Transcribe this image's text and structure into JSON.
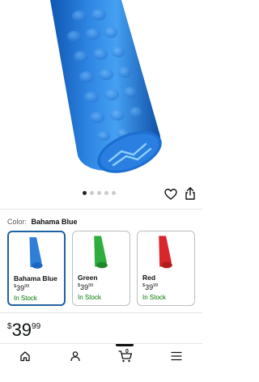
{
  "product": {
    "image_alt": "Blue textured grip",
    "carousel": {
      "total": 5,
      "active_index": 0
    },
    "selected_color_key": "Color:",
    "selected_color_value": "Bahama Blue"
  },
  "swatches": [
    {
      "name": "Bahama Blue",
      "price_symbol": "$",
      "price_whole": "39",
      "price_fraction": "99",
      "stock": "In Stock",
      "color": "#2f7fd8",
      "selected": true
    },
    {
      "name": "Green",
      "price_symbol": "$",
      "price_whole": "39",
      "price_fraction": "99",
      "stock": "In Stock",
      "color": "#2fae3e",
      "selected": false
    },
    {
      "name": "Red",
      "price_symbol": "$",
      "price_whole": "39",
      "price_fraction": "99",
      "stock": "In Stock",
      "color": "#d8262a",
      "selected": false
    }
  ],
  "price": {
    "symbol": "$",
    "whole": "39",
    "fraction": "99"
  },
  "nav": {
    "items": [
      "home-icon",
      "account-icon",
      "cart-icon",
      "menu-icon"
    ],
    "cart_count": "0",
    "active": "cart-icon"
  },
  "colors": {
    "stock_green": "#007600",
    "selected_border": "#2162a1"
  }
}
